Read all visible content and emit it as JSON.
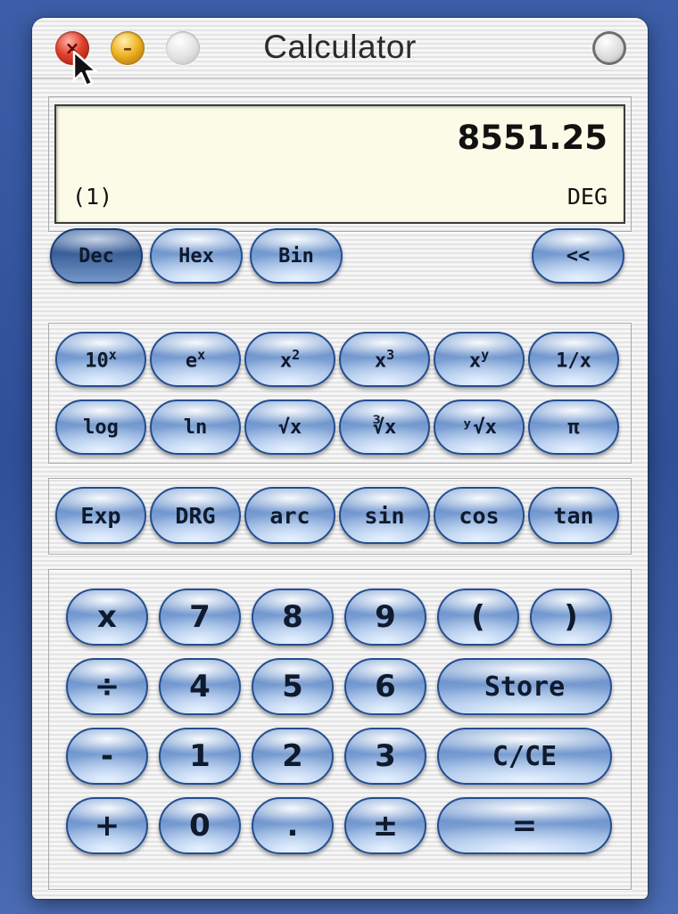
{
  "window": {
    "title": "Calculator"
  },
  "display": {
    "value": "8551.25",
    "paren_count": "(1)",
    "angle_mode": "DEG"
  },
  "mode_buttons": {
    "dec": "Dec",
    "hex": "Hex",
    "bin": "Bin",
    "back": "<<",
    "selected": "Dec"
  },
  "scientific": {
    "row1": [
      {
        "base": "10",
        "sup": "x"
      },
      {
        "base": "e",
        "sup": "x"
      },
      {
        "base": "x",
        "sup": "2"
      },
      {
        "base": "x",
        "sup": "3"
      },
      {
        "base": "x",
        "sup": "y"
      },
      {
        "base": "1/x",
        "sup": ""
      }
    ],
    "row2": [
      "log",
      "ln",
      "√x",
      "∛x",
      "ʸ√x",
      "π"
    ]
  },
  "trig": [
    "Exp",
    "DRG",
    "arc",
    "sin",
    "cos",
    "tan"
  ],
  "keypad": {
    "row1": [
      "x",
      "7",
      "8",
      "9",
      "(",
      ")"
    ],
    "row2": [
      "÷",
      "4",
      "5",
      "6",
      "Store"
    ],
    "row3": [
      "-",
      "1",
      "2",
      "3",
      "C/CE"
    ],
    "row4": [
      "+",
      "0",
      ".",
      "±",
      "="
    ]
  },
  "colors": {
    "button_blue": "#7a9fd3",
    "button_border": "#244d8f",
    "display_bg": "#fbfbe8",
    "close": "#e0412d",
    "minimize": "#f0b324",
    "desktop": "#3c5ea8"
  },
  "icons": {
    "close": "close-icon",
    "minimize": "minimize-icon",
    "zoom": "zoom-icon",
    "toolbar": "toolbar-toggle-icon",
    "cursor": "arrow-cursor-icon"
  }
}
